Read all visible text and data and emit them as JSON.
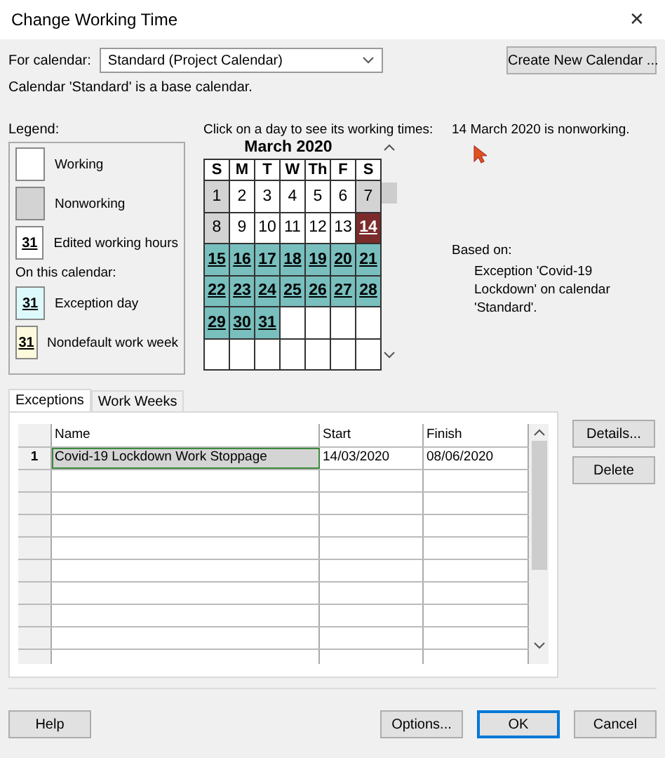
{
  "window": {
    "title": "Change Working Time",
    "close": "✕"
  },
  "calendar_select": {
    "label": "For calendar:",
    "value": "Standard (Project Calendar)"
  },
  "create_button": "Create New Calendar ...",
  "base_note": "Calendar 'Standard' is a base calendar.",
  "legend": {
    "title": "Legend:",
    "items": [
      {
        "kind": "working",
        "label": "Working"
      },
      {
        "kind": "nonworking",
        "label": "Nonworking"
      },
      {
        "kind": "edited",
        "sample": "31",
        "label": "Edited working hours"
      },
      {
        "kind": "heading",
        "label": "On this calendar:"
      },
      {
        "kind": "exception",
        "sample": "31",
        "label": "Exception day"
      },
      {
        "kind": "nondefault",
        "sample": "31",
        "label": "Nondefault work week"
      }
    ]
  },
  "instruction": "Click on a day to see its working times:",
  "month": {
    "title": "March 2020",
    "weekdays": [
      "S",
      "M",
      "T",
      "W",
      "Th",
      "F",
      "S"
    ],
    "weeks": [
      [
        {
          "day": "1",
          "kind": "nonworking",
          "selected": false
        },
        {
          "day": "2",
          "kind": "working",
          "selected": false
        },
        {
          "day": "3",
          "kind": "working",
          "selected": false
        },
        {
          "day": "4",
          "kind": "working",
          "selected": false
        },
        {
          "day": "5",
          "kind": "working",
          "selected": false
        },
        {
          "day": "6",
          "kind": "working",
          "selected": false
        },
        {
          "day": "7",
          "kind": "nonworking",
          "selected": false
        }
      ],
      [
        {
          "day": "8",
          "kind": "nonworking",
          "selected": false
        },
        {
          "day": "9",
          "kind": "working",
          "selected": false
        },
        {
          "day": "10",
          "kind": "working",
          "selected": false
        },
        {
          "day": "11",
          "kind": "working",
          "selected": false
        },
        {
          "day": "12",
          "kind": "working",
          "selected": false
        },
        {
          "day": "13",
          "kind": "working",
          "selected": false
        },
        {
          "day": "14",
          "kind": "exception",
          "selected": true
        }
      ],
      [
        {
          "day": "15",
          "kind": "exception",
          "selected": false
        },
        {
          "day": "16",
          "kind": "exception",
          "selected": false
        },
        {
          "day": "17",
          "kind": "exception",
          "selected": false
        },
        {
          "day": "18",
          "kind": "exception",
          "selected": false
        },
        {
          "day": "19",
          "kind": "exception",
          "selected": false
        },
        {
          "day": "20",
          "kind": "exception",
          "selected": false
        },
        {
          "day": "21",
          "kind": "exception",
          "selected": false
        }
      ],
      [
        {
          "day": "22",
          "kind": "exception",
          "selected": false
        },
        {
          "day": "23",
          "kind": "exception",
          "selected": false
        },
        {
          "day": "24",
          "kind": "exception",
          "selected": false
        },
        {
          "day": "25",
          "kind": "exception",
          "selected": false
        },
        {
          "day": "26",
          "kind": "exception",
          "selected": false
        },
        {
          "day": "27",
          "kind": "exception",
          "selected": false
        },
        {
          "day": "28",
          "kind": "exception",
          "selected": false
        }
      ],
      [
        {
          "day": "29",
          "kind": "exception",
          "selected": false
        },
        {
          "day": "30",
          "kind": "exception",
          "selected": false
        },
        {
          "day": "31",
          "kind": "exception",
          "selected": false
        },
        {
          "kind": "empty"
        },
        {
          "kind": "empty"
        },
        {
          "kind": "empty"
        },
        {
          "kind": "empty"
        }
      ],
      [
        {
          "kind": "empty"
        },
        {
          "kind": "empty"
        },
        {
          "kind": "empty"
        },
        {
          "kind": "empty"
        },
        {
          "kind": "empty"
        },
        {
          "kind": "empty"
        },
        {
          "kind": "empty"
        }
      ]
    ]
  },
  "day_info": "14 March 2020 is nonworking.",
  "based_on": {
    "label": "Based on:",
    "text": "Exception 'Covid-19 Lockdown' on calendar 'Standard'."
  },
  "tabs": [
    {
      "label": "Exceptions",
      "selected": true
    },
    {
      "label": "Work Weeks",
      "selected": false
    }
  ],
  "table": {
    "columns": [
      "Name",
      "Start",
      "Finish"
    ],
    "rows": [
      {
        "index": "1",
        "cells": [
          "Covid-19 Lockdown Work Stoppage",
          "14/03/2020",
          "08/06/2020"
        ],
        "selected": true
      }
    ]
  },
  "side_buttons": [
    "Details...",
    "Delete"
  ],
  "footer_buttons": [
    {
      "label": "Help",
      "kind": "left"
    },
    {
      "label": "Options...",
      "kind": "normal"
    },
    {
      "label": "OK",
      "kind": "default"
    },
    {
      "label": "Cancel",
      "kind": "normal"
    }
  ]
}
